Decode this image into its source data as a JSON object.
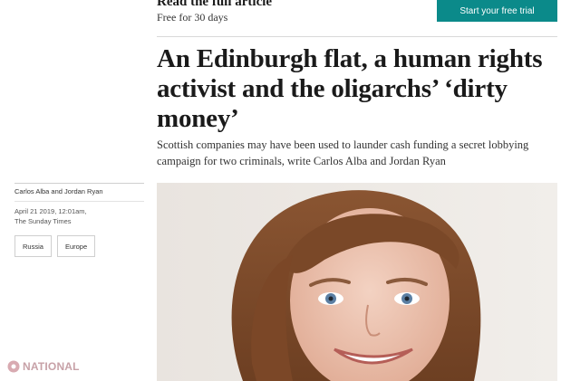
{
  "promo": {
    "title": "Read the full article",
    "subtitle": "Free for 30 days",
    "cta_label": "Start your free trial"
  },
  "article": {
    "headline": "An Edinburgh flat, a human rights activist and the oligarchs’ ‘dirty money’",
    "standfirst": "Scottish companies may have been used to launder cash funding a secret lobbying campaign for two criminals, write Carlos Alba and Jordan Ryan"
  },
  "meta": {
    "authors": "Carlos Alba and Jordan Ryan",
    "date": "April 21 2019, 12:01am,",
    "publication": "The Sunday Times",
    "tags": [
      "Russia",
      "Europe"
    ]
  },
  "watermark": {
    "text": "NATIONAL"
  },
  "colors": {
    "cta_bg": "#0b8a8a",
    "watermark": "#c7a1a7"
  }
}
